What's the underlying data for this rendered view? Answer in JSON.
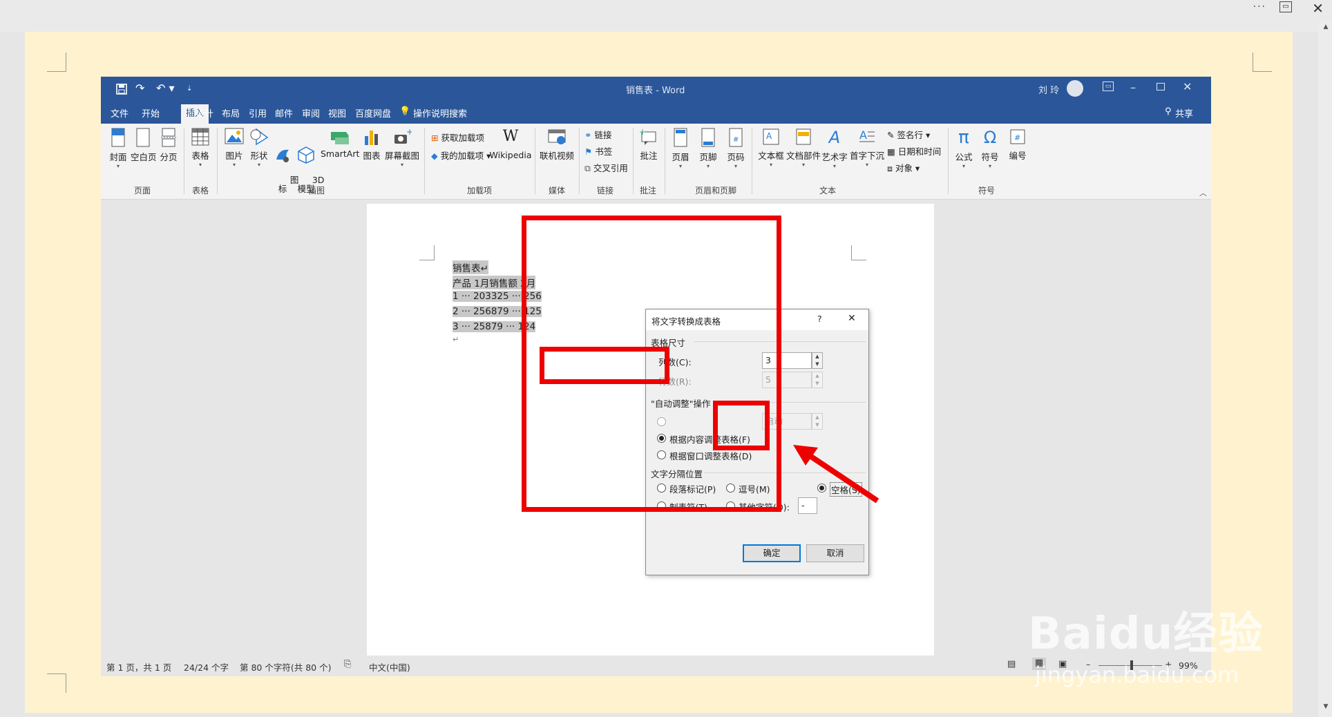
{
  "word": {
    "title": "销售表 - Word",
    "user": "刘 玲",
    "share": "共享",
    "tabs": [
      "文件",
      "开始",
      "插入",
      "设计",
      "布局",
      "引用",
      "邮件",
      "审阅",
      "视图",
      "百度网盘"
    ],
    "tell_me": "操作说明搜索",
    "ribbon": {
      "groups": [
        "页面",
        "表格",
        "插图",
        "加载项",
        "媒体",
        "链接",
        "批注",
        "页眉和页脚",
        "文本",
        "符号"
      ],
      "page": [
        "封面",
        "空白页",
        "分页"
      ],
      "table": "表格",
      "illustrations": [
        "图片",
        "形状",
        "图\n标",
        "3D\n模型",
        "SmartArt",
        "图表",
        "屏幕截图"
      ],
      "addins": [
        "获取加载项",
        "我的加载项"
      ],
      "wikipedia": "Wikipedia",
      "media": "联机视频",
      "links": [
        "链接",
        "书签",
        "交叉引用"
      ],
      "comment": "批注",
      "header_footer": [
        "页眉",
        "页脚",
        "页码"
      ],
      "text": [
        "文本框",
        "文档部件",
        "艺术字",
        "首字下沉"
      ],
      "text_small": [
        "签名行",
        "日期和时间",
        "对象"
      ],
      "symbols": [
        "公式",
        "符号",
        "编号"
      ]
    },
    "document": {
      "lines": [
        "销售表↵",
        "产品 1月销售额 2月",
        "1 ··· 203325 ··· 256",
        "2 ··· 256879 ··· 125",
        "3 ··· 25879 ··· 124",
        "↵"
      ]
    },
    "status": {
      "page": "第 1 页，共 1 页",
      "words": "24/24 个字",
      "chars": "第 80 个字符(共 80 个)",
      "lang": "中文(中国)",
      "zoom": "99%"
    }
  },
  "dialog": {
    "title": "将文字转换成表格",
    "help": "?",
    "close": "✕",
    "size_section": "表格尺寸",
    "cols_label": "列数(C):",
    "cols_value": "3",
    "rows_label": "行数(R):",
    "rows_value": "5",
    "autofit_section": "\"自动调整\"操作",
    "fixed_value": "自动",
    "autofit_contents": "根据内容调整表格(F)",
    "autofit_window": "根据窗口调整表格(D)",
    "sep_section": "文字分隔位置",
    "sep_paragraph": "段落标记(P)",
    "sep_comma": "逗号(M)",
    "sep_space": "空格(S)",
    "sep_tab": "制表符(T)",
    "sep_other": "其他字符(O):",
    "sep_other_value": "-",
    "ok": "确定",
    "cancel": "取消"
  },
  "watermark": {
    "logo": "Baidu经验",
    "url": "jingyan.baidu.com"
  },
  "colors": {
    "ribbon_blue": "#2b579a",
    "highlight_red": "#ee0000"
  }
}
